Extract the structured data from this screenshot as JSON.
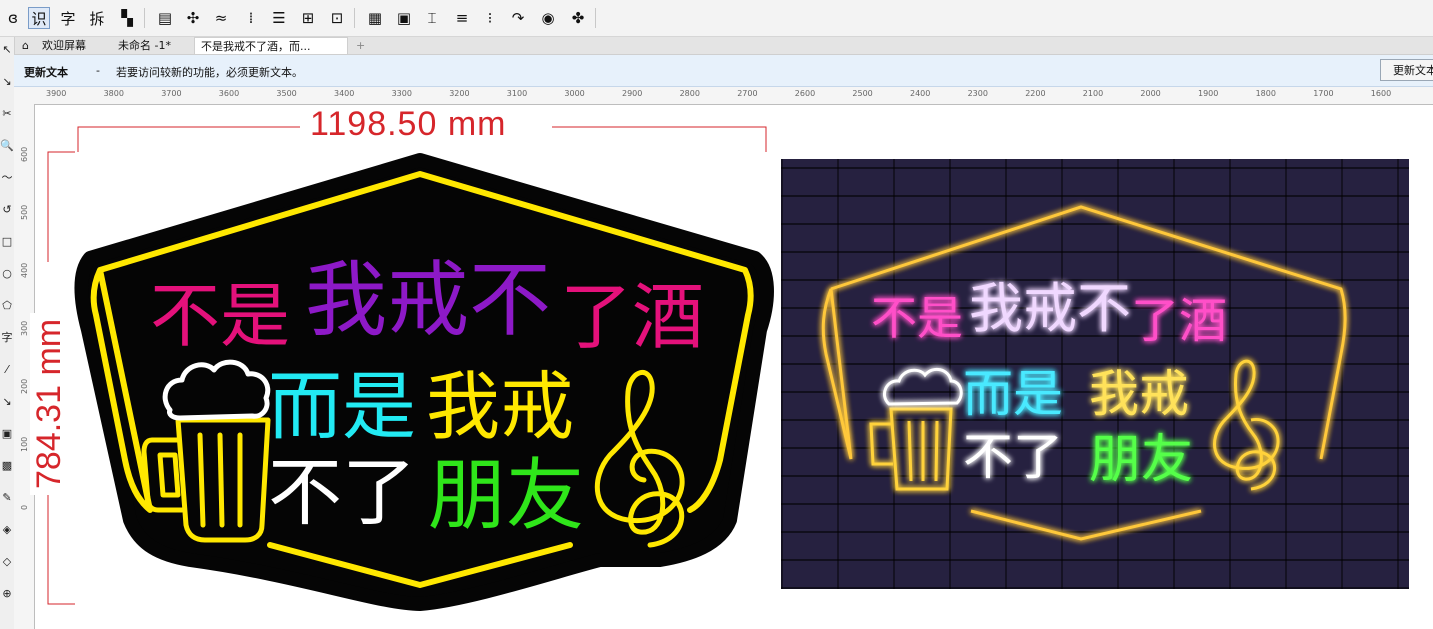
{
  "toolbar": {
    "buttons": [
      {
        "name": "logo-icon",
        "glyph": "ɞ",
        "active": false
      },
      {
        "name": "recognize-button",
        "glyph": "识",
        "active": true
      },
      {
        "name": "text-button",
        "glyph": "字",
        "active": false
      },
      {
        "name": "split-button",
        "glyph": "拆",
        "active": false
      },
      {
        "name": "layers-icon",
        "glyph": "▚",
        "active": false
      },
      {
        "name": "table-icon",
        "glyph": "▤",
        "active": false
      },
      {
        "name": "nodes-icon",
        "glyph": "✣",
        "active": false
      },
      {
        "name": "curve-icon",
        "glyph": "≈",
        "active": false
      },
      {
        "name": "align-icon",
        "glyph": "⁞",
        "active": false
      },
      {
        "name": "distribute-icon",
        "glyph": "☰",
        "active": false
      },
      {
        "name": "group-icon",
        "glyph": "⊞",
        "active": false
      },
      {
        "name": "select-icon",
        "glyph": "⊡",
        "active": false
      },
      {
        "name": "color-icon",
        "glyph": "▦",
        "active": false
      },
      {
        "name": "image-icon",
        "glyph": "▣",
        "active": false
      },
      {
        "name": "crop-icon",
        "glyph": "⌶",
        "active": false
      },
      {
        "name": "list-icon",
        "glyph": "≡",
        "active": false
      },
      {
        "name": "grid-icon",
        "glyph": "⁝",
        "active": false
      },
      {
        "name": "arrow-icon",
        "glyph": "↷",
        "active": false
      },
      {
        "name": "globe-icon",
        "glyph": "◉",
        "active": false
      },
      {
        "name": "plugin-icon",
        "glyph": "✤",
        "active": false
      }
    ]
  },
  "tabs": [
    {
      "label": "欢迎屏幕",
      "active": false
    },
    {
      "label": "未命名 -1*",
      "active": false
    },
    {
      "label": "不是我戒不了酒，而...",
      "active": true
    }
  ],
  "tab_add": "+",
  "notification": {
    "title": "更新文本",
    "dash": "-",
    "message": "若要访问较新的功能，必须更新文本。",
    "button": "更新文本"
  },
  "left_tools": [
    "↖",
    "↘",
    "✂",
    "🔍",
    "〜",
    "↺",
    "□",
    "○",
    "⬠",
    "字",
    "⁄",
    "↘",
    "▣",
    "▩",
    "✎",
    "◈",
    "◇",
    "⊕"
  ],
  "ruler_top": [
    "3900",
    "3800",
    "3700",
    "3600",
    "3500",
    "3400",
    "3300",
    "3200",
    "3100",
    "3000",
    "2900",
    "2800",
    "2700",
    "2600",
    "2500",
    "2400",
    "2300",
    "2200",
    "2100",
    "2000",
    "1900",
    "1800",
    "1700",
    "1600"
  ],
  "ruler_left": [
    "600",
    "500",
    "400",
    "300",
    "200",
    "100",
    "0"
  ],
  "dimensions": {
    "width": "1198.50 mm",
    "height": "784.31 mm"
  },
  "sign": {
    "line1_a": "不是",
    "line1_b": "我戒不",
    "line1_c": "了酒",
    "line2_a": "而是",
    "line2_b": "我戒",
    "line3_a": "不了",
    "line3_b": "朋友"
  },
  "colors": {
    "dimension": "#d6262b",
    "frame": "#ffe800",
    "magenta": "#e4117b",
    "purple": "#8d19c7",
    "cyan": "#22eaf3",
    "yellow": "#ffe800",
    "white": "#ffffff",
    "green": "#2fe61a"
  }
}
